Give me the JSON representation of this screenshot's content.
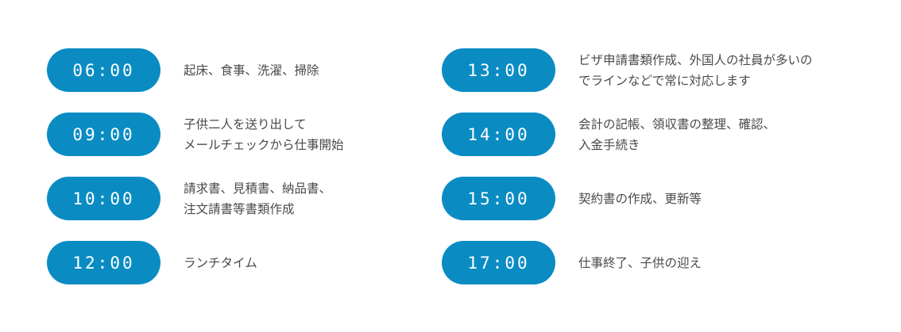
{
  "accent_color": "#0a8cc3",
  "schedule": {
    "left": [
      {
        "time": "06:00",
        "lines": [
          "起床、食事、洗濯、掃除"
        ]
      },
      {
        "time": "09:00",
        "lines": [
          "子供二人を送り出して",
          "メールチェックから仕事開始"
        ]
      },
      {
        "time": "10:00",
        "lines": [
          "請求書、見積書、納品書、",
          "注文請書等書類作成"
        ]
      },
      {
        "time": "12:00",
        "lines": [
          "ランチタイム"
        ]
      }
    ],
    "right": [
      {
        "time": "13:00",
        "lines": [
          "ビザ申請書類作成、外国人の社員が多いの",
          "でラインなどで常に対応します"
        ]
      },
      {
        "time": "14:00",
        "lines": [
          "会計の記帳、領収書の整理、確認、",
          "入金手続き"
        ]
      },
      {
        "time": "15:00",
        "lines": [
          "契約書の作成、更新等"
        ]
      },
      {
        "time": "17:00",
        "lines": [
          "仕事終了、子供の迎え"
        ]
      }
    ]
  }
}
